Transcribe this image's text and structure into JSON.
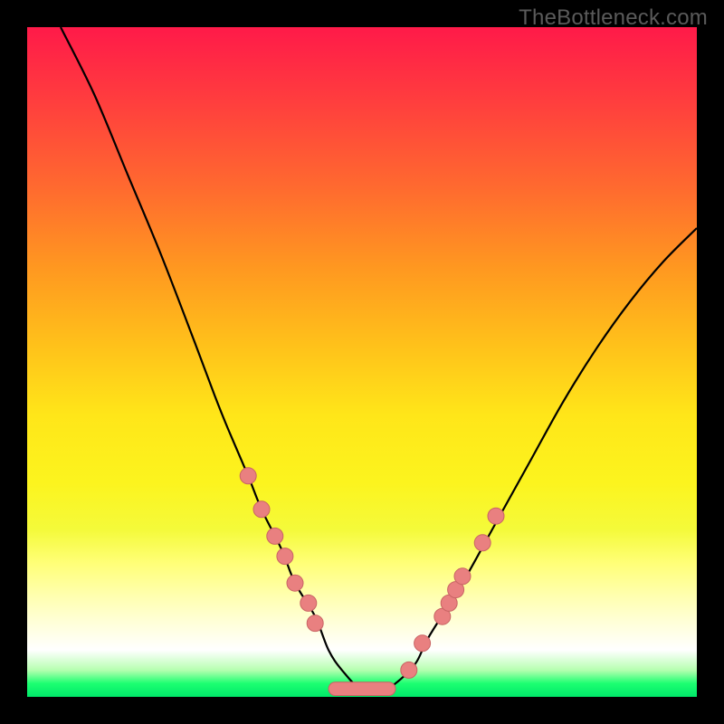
{
  "watermark": "TheBottleneck.com",
  "colors": {
    "frame": "#000000",
    "curve": "#000000",
    "marker_fill": "#e98080",
    "marker_stroke": "#c96464"
  },
  "chart_data": {
    "type": "line",
    "title": "",
    "xlabel": "",
    "ylabel": "",
    "xlim": [
      0,
      100
    ],
    "ylim": [
      0,
      100
    ],
    "grid": false,
    "series": [
      {
        "name": "bottleneck-curve",
        "x": [
          5,
          10,
          15,
          20,
          25,
          28,
          30,
          33,
          35,
          38,
          40,
          43,
          45,
          47,
          50,
          53,
          55,
          58,
          60,
          65,
          70,
          75,
          80,
          85,
          90,
          95,
          100
        ],
        "y": [
          100,
          90,
          78,
          66,
          53,
          45,
          40,
          33,
          28,
          22,
          17,
          12,
          7,
          4,
          1,
          1,
          2,
          5,
          9,
          17,
          26,
          35,
          44,
          52,
          59,
          65,
          70
        ]
      }
    ],
    "markers": {
      "name": "highlighted-points",
      "points": [
        {
          "x": 33,
          "y": 33
        },
        {
          "x": 35,
          "y": 28
        },
        {
          "x": 37,
          "y": 24
        },
        {
          "x": 38.5,
          "y": 21
        },
        {
          "x": 40,
          "y": 17
        },
        {
          "x": 42,
          "y": 14
        },
        {
          "x": 43,
          "y": 11
        },
        {
          "x": 57,
          "y": 4
        },
        {
          "x": 59,
          "y": 8
        },
        {
          "x": 62,
          "y": 12
        },
        {
          "x": 63,
          "y": 14
        },
        {
          "x": 64,
          "y": 16
        },
        {
          "x": 65,
          "y": 18
        },
        {
          "x": 68,
          "y": 23
        },
        {
          "x": 70,
          "y": 27
        }
      ]
    },
    "plateau": {
      "name": "bottom-plateau",
      "x_start": 45,
      "x_end": 55,
      "y": 1.2,
      "thickness": 2.0
    }
  }
}
